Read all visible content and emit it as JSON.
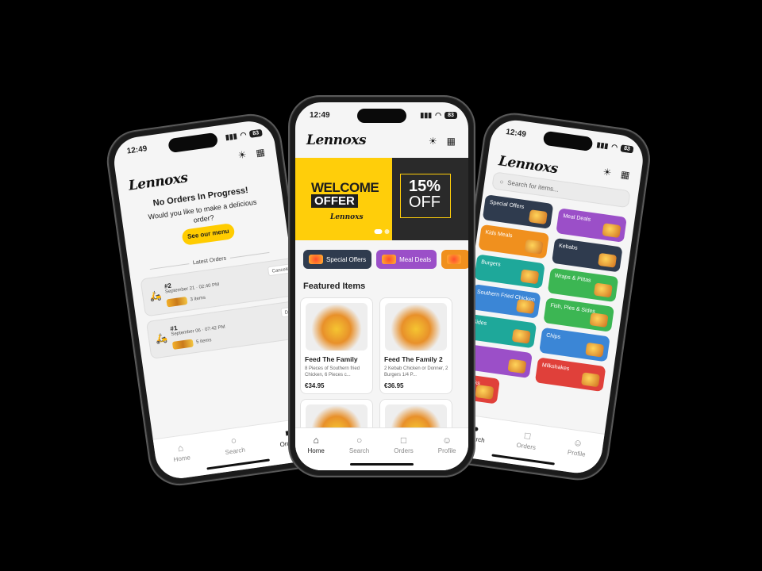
{
  "status_time": "12:49",
  "battery": "83",
  "brand": "Lennoxs",
  "left_phone": {
    "empty_title": "No Orders In Progress!",
    "empty_subtitle": "Would you like to make a delicious order?",
    "see_menu": "See our menu",
    "latest_orders": "Latest Orders",
    "orders": [
      {
        "number": "#2",
        "date": "September 21 · 02:40 PM",
        "items": "3 items",
        "tag": "Cancele"
      },
      {
        "number": "#1",
        "date": "September 06 · 07:42 PM",
        "items": "5 items",
        "tag": "Deliv"
      }
    ],
    "tabs": [
      "Home",
      "Search",
      "Orders"
    ]
  },
  "center_phone": {
    "banner": {
      "welcome": "WELCOME",
      "offer": "OFFER",
      "logo": "Lennoxs",
      "percent": "15%",
      "off": "OFF"
    },
    "chips": [
      {
        "label": "Special Offers",
        "color": "#2f3b4e"
      },
      {
        "label": "Meal Deals",
        "color": "#9b4fc8"
      },
      {
        "label": "",
        "color": "#f0901e"
      }
    ],
    "featured_title": "Featured Items",
    "items": [
      {
        "name": "Feed The Family",
        "desc": "8 Pieces of Southern fried Chicken, 6 Pieces c...",
        "price": "€34.95"
      },
      {
        "name": "Feed The Family 2",
        "desc": "2 Kebab Chicken or Donner, 2 Burgers 1/4 P...",
        "price": "€36.95"
      },
      {
        "name": "",
        "desc": "",
        "price": ""
      },
      {
        "name": "",
        "desc": "",
        "price": ""
      }
    ],
    "tabs": [
      "Home",
      "Search",
      "Orders",
      "Profile"
    ]
  },
  "right_phone": {
    "search_placeholder": "Search for items...",
    "categories": [
      {
        "label": "Special Offers",
        "color": "#2f3b4e"
      },
      {
        "label": "Meal Deals",
        "color": "#9b4fc8"
      },
      {
        "label": "Kids Meals",
        "color": "#f0901e"
      },
      {
        "label": "Kebabs",
        "color": "#2f3b4e"
      },
      {
        "label": "Burgers",
        "color": "#1ea89a"
      },
      {
        "label": "Wraps & Pittas",
        "color": "#3cb653"
      },
      {
        "label": "Southern Fried Chicken",
        "color": "#3b86d6"
      },
      {
        "label": "Fish, Pies & Sides",
        "color": "#3cb653"
      },
      {
        "label": "Sides",
        "color": "#1ea89a"
      },
      {
        "label": "Chips",
        "color": "#3b86d6"
      },
      {
        "label": "",
        "color": "#9b4fc8"
      },
      {
        "label": "Milkshakes",
        "color": "#e0403a"
      },
      {
        "label": "Drinks",
        "color": "#e0403a"
      }
    ],
    "tabs": [
      "Search",
      "Orders",
      "Profile"
    ]
  },
  "icons": {
    "theme": "sun-icon",
    "store": "store-icon",
    "home": "home-icon",
    "search": "search-icon",
    "orders": "bag-icon",
    "profile": "user-icon"
  }
}
